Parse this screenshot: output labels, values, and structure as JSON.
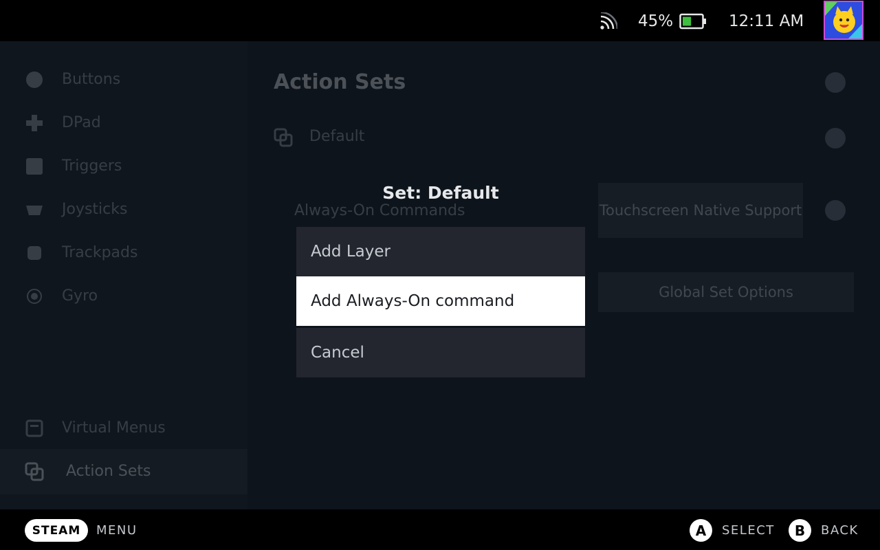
{
  "status_bar": {
    "battery_percent": "45%",
    "battery_level": 0.45,
    "clock": "12:11 AM",
    "icons": [
      "wifi-signal-icon",
      "battery-icon",
      "user-avatar"
    ]
  },
  "sidebar": {
    "items": [
      {
        "label": "Buttons",
        "icon": "buttons-icon"
      },
      {
        "label": "DPad",
        "icon": "dpad-icon"
      },
      {
        "label": "Triggers",
        "icon": "triggers-icon"
      },
      {
        "label": "Joysticks",
        "icon": "joysticks-icon"
      },
      {
        "label": "Trackpads",
        "icon": "trackpads-icon"
      },
      {
        "label": "Gyro",
        "icon": "gyro-icon"
      },
      {
        "label": "Virtual Menus",
        "icon": "virtual-menus-icon"
      },
      {
        "label": "Action Sets",
        "icon": "action-sets-icon",
        "active": true
      }
    ]
  },
  "main": {
    "title": "Action Sets",
    "set_name": "Default",
    "always_on_label": "Always-On Commands",
    "touchscreen_button": "Touchscreen Native Support",
    "global_options_button": "Global Set Options"
  },
  "dialog": {
    "title": "Set: Default",
    "items": [
      {
        "label": "Add Layer",
        "focused": false
      },
      {
        "label": "Add Always-On command",
        "focused": true
      },
      {
        "label": "Cancel",
        "focused": false
      }
    ]
  },
  "footer": {
    "steam_label": "STEAM",
    "menu_label": "MENU",
    "a_glyph": "A",
    "select_label": "SELECT",
    "b_glyph": "B",
    "back_label": "BACK"
  },
  "colors": {
    "background": "#0e141b",
    "dialog_item": "#23262e",
    "focused_item": "#ffffff",
    "battery_fill": "#3fbf3f"
  }
}
